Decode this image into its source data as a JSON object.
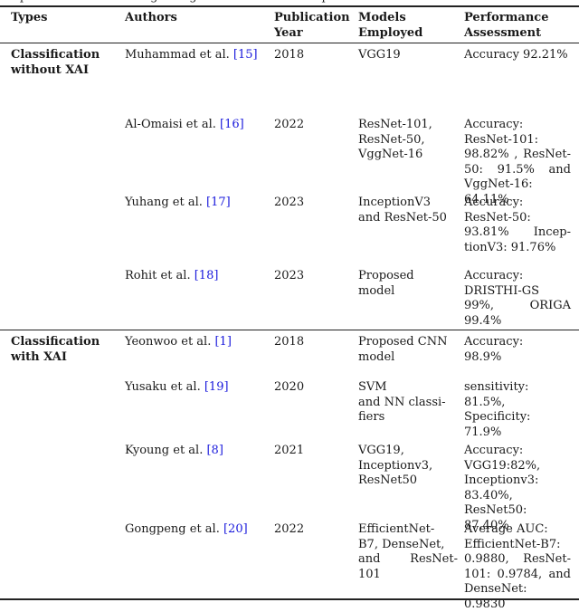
{
  "caption": "representative works regarding classification and explainable AI",
  "headers": {
    "types": "Types",
    "authors": "Authors",
    "year": [
      "Publication",
      "Year"
    ],
    "models": [
      "Models",
      "Employed"
    ],
    "performance": [
      "Performance",
      "Assessment"
    ]
  },
  "groups": [
    {
      "type": [
        "Classification",
        "without XAI"
      ],
      "rows": [
        {
          "author": "Muhammad et al. ",
          "ref": "[15]",
          "year": "2018",
          "models": [
            "VGG19"
          ],
          "performance": [
            "Accuracy 92.21%"
          ]
        },
        {
          "author": "Al-Omaisi et al. ",
          "ref": "[16]",
          "year": "2022",
          "models": [
            "ResNet-101,",
            "ResNet-50,",
            "VggNet-16"
          ],
          "performance": [
            "Accuracy:",
            "ResNet-101:",
            "98.82% , ResNet-",
            "50: 91.5% and",
            "VggNet-16:",
            "64.11%"
          ]
        },
        {
          "author": "Yuhang et al. ",
          "ref": "[17]",
          "year": "2023",
          "models": [
            "InceptionV3",
            "and ResNet-50"
          ],
          "performance": [
            "Accuracy:",
            "ResNet-50:",
            "93.81% Incep-",
            "tionV3: 91.76%"
          ]
        },
        {
          "author": "Rohit et al. ",
          "ref": "[18]",
          "year": "2023",
          "models": [
            "Proposed",
            "model"
          ],
          "performance": [
            "Accuracy:",
            "DRISTHI-GS",
            "99%, ORIGA",
            "99.4%"
          ]
        }
      ]
    },
    {
      "type": [
        "Classification",
        "with XAI"
      ],
      "rows": [
        {
          "author": "Yeonwoo et al. ",
          "ref": "[1]",
          "year": "2018",
          "models": [
            "Proposed CNN",
            "model"
          ],
          "performance": [
            "Accuracy:",
            "98.9%"
          ]
        },
        {
          "author": "Yusaku et al. ",
          "ref": "[19]",
          "year": "2020",
          "models": [
            "SVM",
            "and NN classi-",
            "fiers"
          ],
          "performance": [
            "sensitivity: 81.5%,",
            "Specificity: 71.9%"
          ]
        },
        {
          "author": "Kyoung et al. ",
          "ref": "[8]",
          "year": "2021",
          "models": [
            "VGG19,",
            "Inceptionv3,",
            "ResNet50"
          ],
          "performance": [
            "Accuracy:",
            "VGG19:82%,",
            "Inceptionv3:",
            "83.40%,",
            "ResNet50: 87.40%"
          ]
        },
        {
          "author": "Gongpeng et al. ",
          "ref": "[20]",
          "year": "2022",
          "models": [
            "EfficientNet-",
            "B7, DenseNet,",
            "and ResNet-",
            "101"
          ],
          "performance": [
            "Average AUC:",
            "EfficientNet-B7:",
            "0.9880, ResNet-",
            "101: 0.9784, and",
            "DenseNet: 0.9830"
          ]
        }
      ]
    }
  ]
}
